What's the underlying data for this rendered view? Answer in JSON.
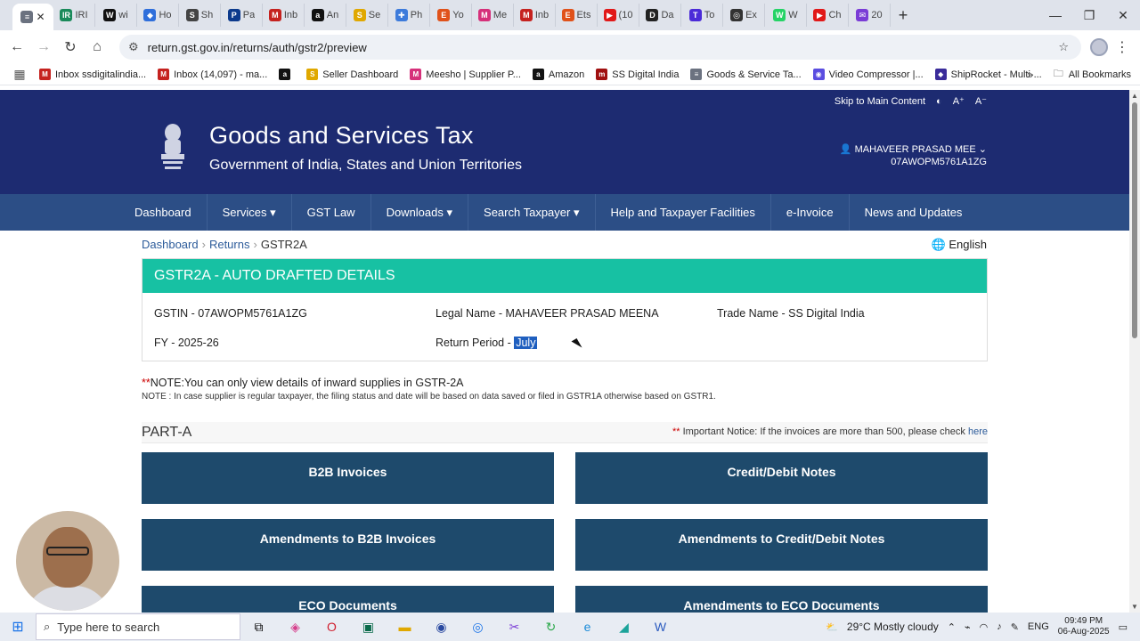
{
  "browser": {
    "tabs": [
      {
        "label": "",
        "color": "#6b7280",
        "glyph": "≡",
        "active": true
      },
      {
        "label": "IRI",
        "color": "#1a8a5a",
        "glyph": "IR"
      },
      {
        "label": "wi",
        "color": "#111111",
        "glyph": "W"
      },
      {
        "label": "Ho",
        "color": "#2f6fdb",
        "glyph": "◆"
      },
      {
        "label": "Sh",
        "color": "#444444",
        "glyph": "S"
      },
      {
        "label": "Pa",
        "color": "#0c3a8c",
        "glyph": "P"
      },
      {
        "label": "Inb",
        "color": "#c5221f",
        "glyph": "M"
      },
      {
        "label": "An",
        "color": "#111111",
        "glyph": "a"
      },
      {
        "label": "Se",
        "color": "#e0a800",
        "glyph": "S"
      },
      {
        "label": "Ph",
        "color": "#3d7bdb",
        "glyph": "✚"
      },
      {
        "label": "Yo",
        "color": "#e0521a",
        "glyph": "E"
      },
      {
        "label": "Me",
        "color": "#d6307a",
        "glyph": "M"
      },
      {
        "label": "Inb",
        "color": "#c5221f",
        "glyph": "M"
      },
      {
        "label": "Ets",
        "color": "#e0521a",
        "glyph": "E"
      },
      {
        "label": "(10",
        "color": "#e11919",
        "glyph": "▶"
      },
      {
        "label": "Da",
        "color": "#222222",
        "glyph": "D"
      },
      {
        "label": "To",
        "color": "#4b2bd8",
        "glyph": "T"
      },
      {
        "label": "Ex",
        "color": "#333333",
        "glyph": "◎"
      },
      {
        "label": "W",
        "color": "#25d366",
        "glyph": "W"
      },
      {
        "label": "Ch",
        "color": "#e11919",
        "glyph": "▶"
      },
      {
        "label": "20",
        "color": "#7a3cd6",
        "glyph": "✉"
      }
    ],
    "url": "return.gst.gov.in/returns/auth/gstr2/preview",
    "bookmarks": [
      {
        "label": "Inbox ssdigitalindia...",
        "color": "#c5221f",
        "glyph": "M"
      },
      {
        "label": "Inbox (14,097) - ma...",
        "color": "#c5221f",
        "glyph": "M"
      },
      {
        "label": "",
        "color": "#111111",
        "glyph": "a"
      },
      {
        "label": "Seller Dashboard",
        "color": "#e0a800",
        "glyph": "S"
      },
      {
        "label": "Meesho | Supplier P...",
        "color": "#d6307a",
        "glyph": "M"
      },
      {
        "label": "Amazon",
        "color": "#111111",
        "glyph": "a"
      },
      {
        "label": "SS Digital India",
        "color": "#a01010",
        "glyph": "m"
      },
      {
        "label": "Goods & Service Ta...",
        "color": "#6b7280",
        "glyph": "≡"
      },
      {
        "label": "Video Compressor |...",
        "color": "#5a4de0",
        "glyph": "◉"
      },
      {
        "label": "ShipRocket - Multi-...",
        "color": "#3a2c9a",
        "glyph": "◆"
      }
    ],
    "all_bookmarks": "All Bookmarks"
  },
  "header": {
    "skip": "Skip to Main Content",
    "contrast": "◐",
    "font_up": "A⁺",
    "font_down": "A⁻",
    "title": "Goods and Services Tax",
    "subtitle": "Government of India, States and Union Territories",
    "user_name": "MAHAVEER PRASAD MEE",
    "user_gstin": "07AWOPM5761A1ZG"
  },
  "nav": [
    {
      "label": "Dashboard",
      "dropdown": false
    },
    {
      "label": "Services",
      "dropdown": true
    },
    {
      "label": "GST Law",
      "dropdown": false
    },
    {
      "label": "Downloads",
      "dropdown": true
    },
    {
      "label": "Search Taxpayer",
      "dropdown": true
    },
    {
      "label": "Help and Taxpayer Facilities",
      "dropdown": false
    },
    {
      "label": "e-Invoice",
      "dropdown": false
    },
    {
      "label": "News and Updates",
      "dropdown": false
    }
  ],
  "breadcrumb": {
    "c1": "Dashboard",
    "c2": "Returns",
    "c3": "GSTR2A"
  },
  "language": "English",
  "panel": {
    "title": "GSTR2A - AUTO DRAFTED DETAILS",
    "gstin": "GSTIN - 07AWOPM5761A1ZG",
    "legal_name": "Legal Name - MAHAVEER PRASAD MEENA",
    "trade_name": "Trade Name - SS Digital India",
    "fy": "FY - 2025-26",
    "return_period_label": "Return Period - ",
    "return_period_value": "July"
  },
  "notes": {
    "stars": "**",
    "main": "NOTE:You can only view details of inward supplies in GSTR-2A",
    "sub": "NOTE : In case supplier is regular taxpayer, the filing status and date will be based on data saved or filed in GSTR1A otherwise based on GSTR1."
  },
  "part_a": {
    "title": "PART-A",
    "notice_stars": "**",
    "notice": "Important Notice: If the invoices are more than 500, please check",
    "notice_link": "here"
  },
  "tiles": {
    "b2b": "B2B Invoices",
    "cdn": "Credit/Debit Notes",
    "amend_b2b": "Amendments to B2B Invoices",
    "amend_cdn": "Amendments to Credit/Debit Notes",
    "eco": "ECO Documents",
    "amend_eco": "Amendments to ECO Documents"
  },
  "taskbar": {
    "search_placeholder": "Type here to search",
    "weather": "29°C  Mostly cloudy",
    "lang": "ENG",
    "time": "09:49 PM",
    "date": "06-Aug-2025"
  }
}
